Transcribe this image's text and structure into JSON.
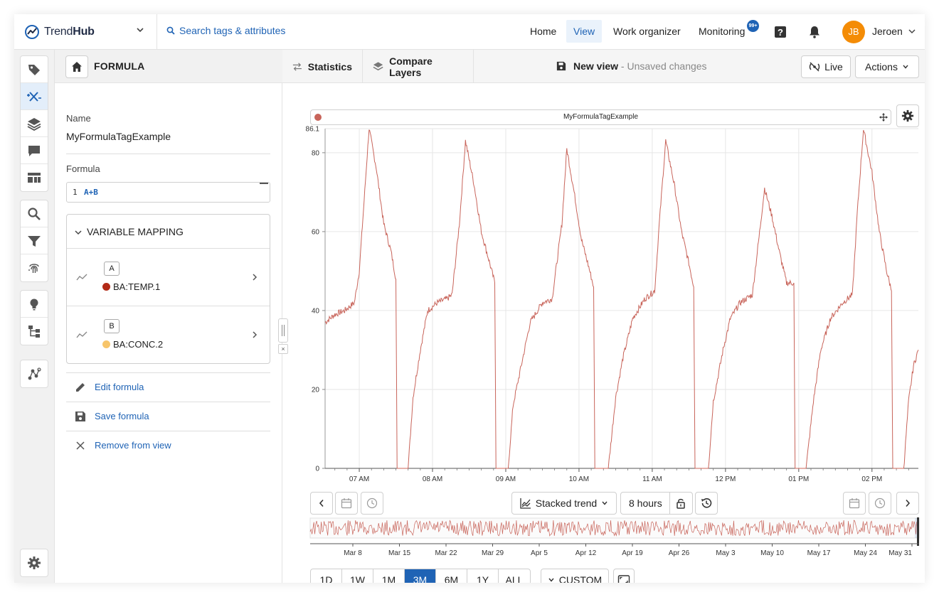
{
  "app": {
    "brand_prefix": "Trend",
    "brand_suffix": "Hub",
    "search_placeholder": "Search tags & attributes"
  },
  "nav": {
    "items": [
      {
        "label": "Home",
        "active": false
      },
      {
        "label": "View",
        "active": true
      },
      {
        "label": "Work organizer",
        "active": false
      },
      {
        "label": "Monitoring",
        "active": false
      }
    ],
    "monitoring_badge": "99+",
    "user_initials": "JB",
    "user_name": "Jeroen"
  },
  "rail": {
    "icons": [
      "tag-icon",
      "formula-icon",
      "layers-icon",
      "comment-icon",
      "dashboard-icon",
      "search-icon",
      "filter-icon",
      "fingerprint-icon",
      "lightbulb-icon",
      "hierarchy-icon",
      "graph-icon",
      "settings-icon"
    ],
    "active": "formula-icon"
  },
  "formula_panel": {
    "title": "FORMULA",
    "name_label": "Name",
    "name_value": "MyFormulaTagExample",
    "formula_label": "Formula",
    "line_number": "1",
    "formula_text": "A+B",
    "variable_mapping_title": "VARIABLE MAPPING",
    "variables": [
      {
        "letter": "A",
        "tag": "BA:TEMP.1",
        "color": "#b22a17"
      },
      {
        "letter": "B",
        "tag": "BA:CONC.2",
        "color": "#f7c56b"
      }
    ],
    "actions": {
      "edit": "Edit formula",
      "save": "Save formula",
      "remove": "Remove from view"
    }
  },
  "toolbar": {
    "statistics": "Statistics",
    "compare_layers": "Compare Layers",
    "view_name": "New view",
    "unsaved": "- Unsaved changes",
    "live": "Live",
    "actions": "Actions"
  },
  "chart_legend": {
    "series_name": "MyFormulaTagExample",
    "series_color": "#c8645a"
  },
  "controls": {
    "stacked_trend": "Stacked trend",
    "duration": "8 hours",
    "custom": "CUSTOM",
    "ranges": [
      "1D",
      "1W",
      "1M",
      "3M",
      "6M",
      "1Y",
      "ALL"
    ],
    "active_range": "3M"
  },
  "chart_data": {
    "type": "line",
    "series": [
      {
        "color": "#c8645a",
        "points": [
          [
            "06:32",
            37
          ],
          [
            "06:40",
            39
          ],
          [
            "06:48",
            40
          ],
          [
            "06:56",
            42
          ],
          [
            "07:00",
            50
          ],
          [
            "07:04",
            68
          ],
          [
            "07:08",
            86.1
          ],
          [
            "07:14",
            76
          ],
          [
            "07:20",
            62
          ],
          [
            "07:26",
            55
          ],
          [
            "07:30",
            48
          ],
          [
            "07:31",
            0
          ],
          [
            "07:40",
            0
          ],
          [
            "07:44",
            18
          ],
          [
            "07:50",
            30
          ],
          [
            "07:56",
            40
          ],
          [
            "08:04",
            42
          ],
          [
            "08:12",
            43
          ],
          [
            "08:16",
            44
          ],
          [
            "08:22",
            62
          ],
          [
            "08:27",
            83
          ],
          [
            "08:34",
            72
          ],
          [
            "08:40",
            60
          ],
          [
            "08:46",
            53
          ],
          [
            "08:51",
            47
          ],
          [
            "08:52",
            0
          ],
          [
            "09:02",
            0
          ],
          [
            "09:06",
            16
          ],
          [
            "09:14",
            28
          ],
          [
            "09:20",
            37
          ],
          [
            "09:30",
            42
          ],
          [
            "09:38",
            43
          ],
          [
            "09:46",
            62
          ],
          [
            "09:50",
            81
          ],
          [
            "09:56",
            70
          ],
          [
            "10:02",
            58
          ],
          [
            "10:08",
            51
          ],
          [
            "10:12",
            46
          ],
          [
            "10:13",
            0
          ],
          [
            "10:24",
            0
          ],
          [
            "10:30",
            18
          ],
          [
            "10:36",
            28
          ],
          [
            "10:44",
            38
          ],
          [
            "10:54",
            43
          ],
          [
            "11:02",
            45
          ],
          [
            "11:06",
            63
          ],
          [
            "11:11",
            83
          ],
          [
            "11:18",
            72
          ],
          [
            "11:24",
            60
          ],
          [
            "11:30",
            52
          ],
          [
            "11:34",
            46
          ],
          [
            "11:35",
            0
          ],
          [
            "11:46",
            0
          ],
          [
            "11:50",
            17
          ],
          [
            "11:58",
            30
          ],
          [
            "12:04",
            38
          ],
          [
            "12:12",
            42
          ],
          [
            "12:22",
            44
          ],
          [
            "12:28",
            60
          ],
          [
            "12:32",
            71
          ],
          [
            "12:38",
            64
          ],
          [
            "12:44",
            55
          ],
          [
            "12:50",
            47
          ],
          [
            "12:56",
            47
          ],
          [
            "12:57",
            0
          ],
          [
            "13:06",
            0
          ],
          [
            "13:12",
            17
          ],
          [
            "13:18",
            30
          ],
          [
            "13:26",
            38
          ],
          [
            "13:36",
            42
          ],
          [
            "13:44",
            44
          ],
          [
            "13:48",
            65
          ],
          [
            "13:53",
            86
          ],
          [
            "14:00",
            75
          ],
          [
            "14:06",
            60
          ],
          [
            "14:12",
            50
          ],
          [
            "14:16",
            45
          ],
          [
            "14:17",
            0
          ],
          [
            "14:26",
            0
          ],
          [
            "14:30",
            17
          ],
          [
            "14:34",
            26
          ],
          [
            "14:38",
            30
          ]
        ]
      }
    ],
    "x_tick_labels": [
      "07 AM",
      "08 AM",
      "09 AM",
      "10 AM",
      "11 AM",
      "12 PM",
      "01 PM",
      "02 PM"
    ],
    "y_tick_labels": [
      "0",
      "20",
      "40",
      "60",
      "80"
    ],
    "y_max_label": "86.1",
    "ylim": [
      0,
      86.1
    ],
    "xlim": [
      "06:32",
      "14:38"
    ],
    "grid": true,
    "overview": {
      "tick_labels": [
        "Mar 8",
        "Mar 15",
        "Mar 22",
        "Mar 29",
        "Apr 5",
        "Apr 12",
        "Apr 19",
        "Apr 26",
        "May 3",
        "May 10",
        "May 17",
        "May 24",
        "May 31"
      ]
    }
  }
}
